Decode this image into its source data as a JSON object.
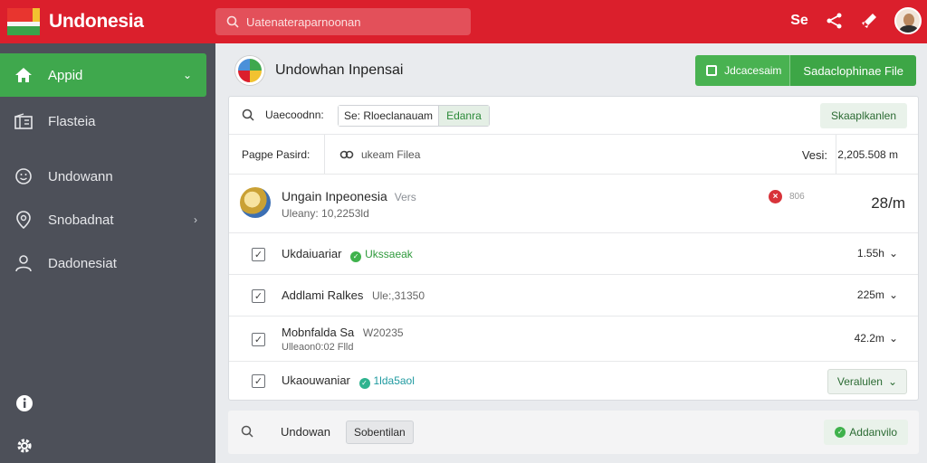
{
  "app": {
    "brand": "Undonesia",
    "search_placeholder": "Uatenateraparnoonan",
    "top_badge": "Se"
  },
  "sidebar": {
    "items": [
      {
        "label": "Appid",
        "active": true
      },
      {
        "label": "Flasteia"
      },
      {
        "label": "Undowann"
      },
      {
        "label": "Snobadnat"
      },
      {
        "label": "Dadonesiat"
      }
    ]
  },
  "main": {
    "title": "Undowhan Inpensai",
    "split_button": {
      "left": "Jdcacesaim",
      "right": "Sadaclophinae File"
    },
    "filter": {
      "label": "Uaecoodnn:",
      "chip_text": "Se: Rloeclanauam",
      "chip_selected": "Edanra",
      "right_button": "Skaaplkanlen"
    },
    "page_info": {
      "label": "Pagpe Pasird:",
      "files": "ukeam Filea",
      "version_label": "Vesi:",
      "size": "2,205.508 m"
    },
    "item": {
      "name": "Ungain Inpeonesia",
      "version": "Vers",
      "sub": "Uleany: 10,2253ld",
      "status_text": "806",
      "big_value": "28/m"
    },
    "rows": [
      {
        "title": "Ukdaiuariar",
        "badge": "Ukssaeak",
        "value": "1.55h"
      },
      {
        "title": "Addlami Ralkes",
        "badge": "Ule:,31350",
        "value": "225m"
      },
      {
        "title": "Mobnfalda Sa",
        "badge": "W20235",
        "sub": "Ulleaon0:02 Flld",
        "value": "42.2m"
      },
      {
        "title": "Ukaouwaniar",
        "badge": "1lda5aol",
        "value": "Veralulen"
      }
    ],
    "footer": {
      "label": "Undowan",
      "button": "Sobentilan",
      "right": "Addanvilo"
    }
  }
}
